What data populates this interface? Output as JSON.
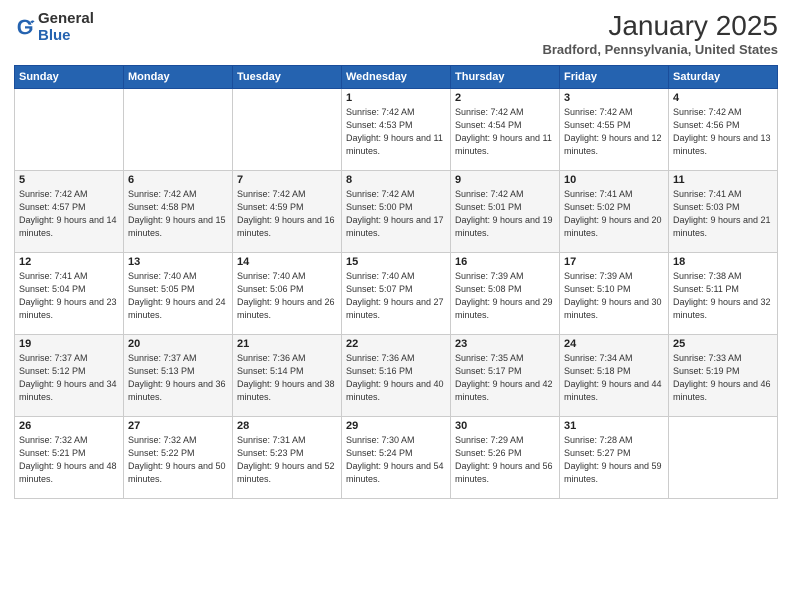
{
  "logo": {
    "general": "General",
    "blue": "Blue"
  },
  "header": {
    "month": "January 2025",
    "location": "Bradford, Pennsylvania, United States"
  },
  "days_of_week": [
    "Sunday",
    "Monday",
    "Tuesday",
    "Wednesday",
    "Thursday",
    "Friday",
    "Saturday"
  ],
  "weeks": [
    [
      {
        "day": "",
        "sunrise": "",
        "sunset": "",
        "daylight": ""
      },
      {
        "day": "",
        "sunrise": "",
        "sunset": "",
        "daylight": ""
      },
      {
        "day": "",
        "sunrise": "",
        "sunset": "",
        "daylight": ""
      },
      {
        "day": "1",
        "sunrise": "Sunrise: 7:42 AM",
        "sunset": "Sunset: 4:53 PM",
        "daylight": "Daylight: 9 hours and 11 minutes."
      },
      {
        "day": "2",
        "sunrise": "Sunrise: 7:42 AM",
        "sunset": "Sunset: 4:54 PM",
        "daylight": "Daylight: 9 hours and 11 minutes."
      },
      {
        "day": "3",
        "sunrise": "Sunrise: 7:42 AM",
        "sunset": "Sunset: 4:55 PM",
        "daylight": "Daylight: 9 hours and 12 minutes."
      },
      {
        "day": "4",
        "sunrise": "Sunrise: 7:42 AM",
        "sunset": "Sunset: 4:56 PM",
        "daylight": "Daylight: 9 hours and 13 minutes."
      }
    ],
    [
      {
        "day": "5",
        "sunrise": "Sunrise: 7:42 AM",
        "sunset": "Sunset: 4:57 PM",
        "daylight": "Daylight: 9 hours and 14 minutes."
      },
      {
        "day": "6",
        "sunrise": "Sunrise: 7:42 AM",
        "sunset": "Sunset: 4:58 PM",
        "daylight": "Daylight: 9 hours and 15 minutes."
      },
      {
        "day": "7",
        "sunrise": "Sunrise: 7:42 AM",
        "sunset": "Sunset: 4:59 PM",
        "daylight": "Daylight: 9 hours and 16 minutes."
      },
      {
        "day": "8",
        "sunrise": "Sunrise: 7:42 AM",
        "sunset": "Sunset: 5:00 PM",
        "daylight": "Daylight: 9 hours and 17 minutes."
      },
      {
        "day": "9",
        "sunrise": "Sunrise: 7:42 AM",
        "sunset": "Sunset: 5:01 PM",
        "daylight": "Daylight: 9 hours and 19 minutes."
      },
      {
        "day": "10",
        "sunrise": "Sunrise: 7:41 AM",
        "sunset": "Sunset: 5:02 PM",
        "daylight": "Daylight: 9 hours and 20 minutes."
      },
      {
        "day": "11",
        "sunrise": "Sunrise: 7:41 AM",
        "sunset": "Sunset: 5:03 PM",
        "daylight": "Daylight: 9 hours and 21 minutes."
      }
    ],
    [
      {
        "day": "12",
        "sunrise": "Sunrise: 7:41 AM",
        "sunset": "Sunset: 5:04 PM",
        "daylight": "Daylight: 9 hours and 23 minutes."
      },
      {
        "day": "13",
        "sunrise": "Sunrise: 7:40 AM",
        "sunset": "Sunset: 5:05 PM",
        "daylight": "Daylight: 9 hours and 24 minutes."
      },
      {
        "day": "14",
        "sunrise": "Sunrise: 7:40 AM",
        "sunset": "Sunset: 5:06 PM",
        "daylight": "Daylight: 9 hours and 26 minutes."
      },
      {
        "day": "15",
        "sunrise": "Sunrise: 7:40 AM",
        "sunset": "Sunset: 5:07 PM",
        "daylight": "Daylight: 9 hours and 27 minutes."
      },
      {
        "day": "16",
        "sunrise": "Sunrise: 7:39 AM",
        "sunset": "Sunset: 5:08 PM",
        "daylight": "Daylight: 9 hours and 29 minutes."
      },
      {
        "day": "17",
        "sunrise": "Sunrise: 7:39 AM",
        "sunset": "Sunset: 5:10 PM",
        "daylight": "Daylight: 9 hours and 30 minutes."
      },
      {
        "day": "18",
        "sunrise": "Sunrise: 7:38 AM",
        "sunset": "Sunset: 5:11 PM",
        "daylight": "Daylight: 9 hours and 32 minutes."
      }
    ],
    [
      {
        "day": "19",
        "sunrise": "Sunrise: 7:37 AM",
        "sunset": "Sunset: 5:12 PM",
        "daylight": "Daylight: 9 hours and 34 minutes."
      },
      {
        "day": "20",
        "sunrise": "Sunrise: 7:37 AM",
        "sunset": "Sunset: 5:13 PM",
        "daylight": "Daylight: 9 hours and 36 minutes."
      },
      {
        "day": "21",
        "sunrise": "Sunrise: 7:36 AM",
        "sunset": "Sunset: 5:14 PM",
        "daylight": "Daylight: 9 hours and 38 minutes."
      },
      {
        "day": "22",
        "sunrise": "Sunrise: 7:36 AM",
        "sunset": "Sunset: 5:16 PM",
        "daylight": "Daylight: 9 hours and 40 minutes."
      },
      {
        "day": "23",
        "sunrise": "Sunrise: 7:35 AM",
        "sunset": "Sunset: 5:17 PM",
        "daylight": "Daylight: 9 hours and 42 minutes."
      },
      {
        "day": "24",
        "sunrise": "Sunrise: 7:34 AM",
        "sunset": "Sunset: 5:18 PM",
        "daylight": "Daylight: 9 hours and 44 minutes."
      },
      {
        "day": "25",
        "sunrise": "Sunrise: 7:33 AM",
        "sunset": "Sunset: 5:19 PM",
        "daylight": "Daylight: 9 hours and 46 minutes."
      }
    ],
    [
      {
        "day": "26",
        "sunrise": "Sunrise: 7:32 AM",
        "sunset": "Sunset: 5:21 PM",
        "daylight": "Daylight: 9 hours and 48 minutes."
      },
      {
        "day": "27",
        "sunrise": "Sunrise: 7:32 AM",
        "sunset": "Sunset: 5:22 PM",
        "daylight": "Daylight: 9 hours and 50 minutes."
      },
      {
        "day": "28",
        "sunrise": "Sunrise: 7:31 AM",
        "sunset": "Sunset: 5:23 PM",
        "daylight": "Daylight: 9 hours and 52 minutes."
      },
      {
        "day": "29",
        "sunrise": "Sunrise: 7:30 AM",
        "sunset": "Sunset: 5:24 PM",
        "daylight": "Daylight: 9 hours and 54 minutes."
      },
      {
        "day": "30",
        "sunrise": "Sunrise: 7:29 AM",
        "sunset": "Sunset: 5:26 PM",
        "daylight": "Daylight: 9 hours and 56 minutes."
      },
      {
        "day": "31",
        "sunrise": "Sunrise: 7:28 AM",
        "sunset": "Sunset: 5:27 PM",
        "daylight": "Daylight: 9 hours and 59 minutes."
      },
      {
        "day": "",
        "sunrise": "",
        "sunset": "",
        "daylight": ""
      }
    ]
  ]
}
